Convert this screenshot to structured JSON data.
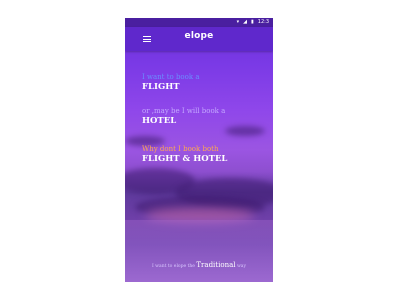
{
  "status_bar": {
    "time": "12:3"
  },
  "app_bar": {
    "title": "elope"
  },
  "options": [
    {
      "prefix": "I want to book a",
      "label": "FLIGHT"
    },
    {
      "prefix": "or ,may be I will book a",
      "label": "HOTEL"
    },
    {
      "prefix": "Why dont I book both",
      "label": "FLIGHT & HOTEL"
    }
  ],
  "footer": {
    "before": "I want to elope the",
    "highlight": "Traditional",
    "after": "way"
  },
  "colors": {
    "app_bar": "#5f28cc",
    "status_bar": "#4a1fa0",
    "flight_prefix": "#6a8dff",
    "hotel_prefix": "#c4a8ff",
    "both_prefix": "#ffa94d"
  },
  "icons": [
    "menu-icon",
    "wifi-icon",
    "signal-icon",
    "battery-icon"
  ]
}
